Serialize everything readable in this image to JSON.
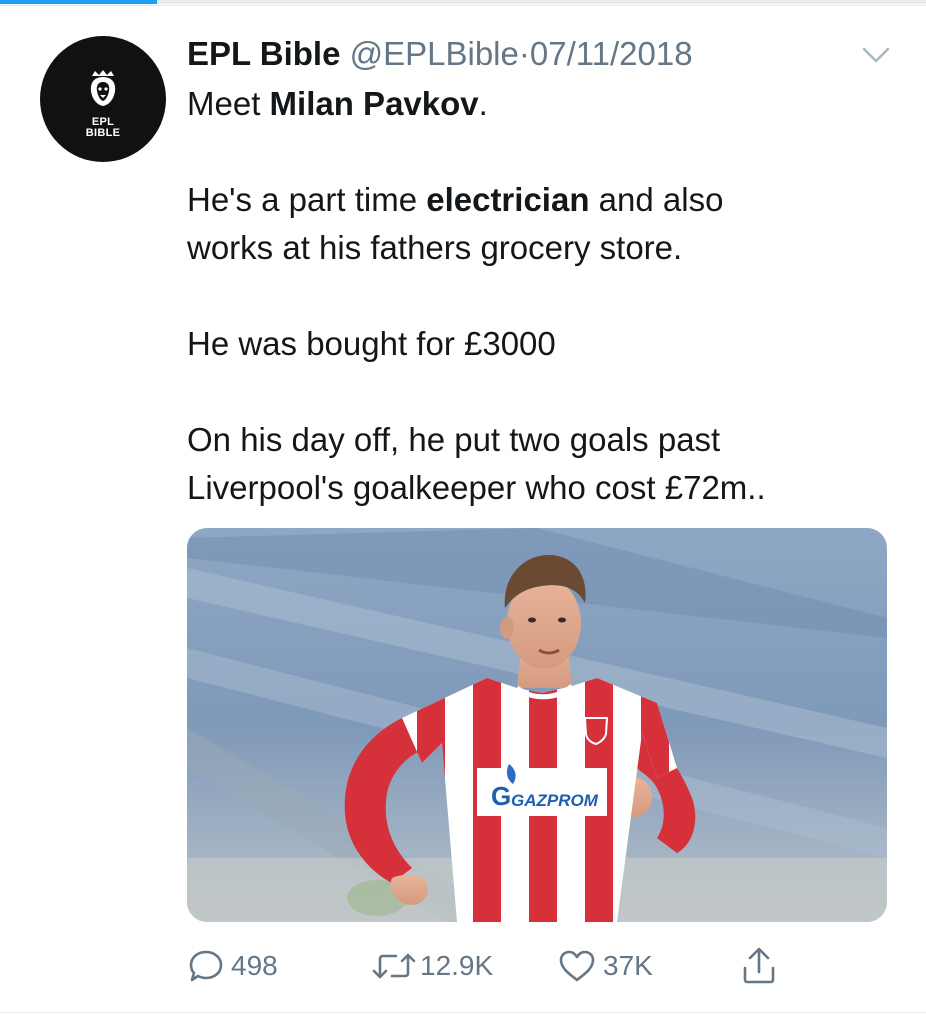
{
  "tweet": {
    "author_name": "EPL Bible",
    "handle": "@EPLBible",
    "separator": "·",
    "date": "07/11/2018",
    "avatar_text_top": "EPL",
    "avatar_text_bottom": "BIBLE",
    "line1_prefix": "Meet ",
    "line1_bold": "Milan Pavkov",
    "line1_suffix": ".",
    "line2_prefix": "He's a part time ",
    "line2_bold": "electrician",
    "line2_suffix": " and also",
    "line3": "works at his fathers grocery store.",
    "line4": "He was bought for £3000",
    "line5": "On his day off, he put two goals past",
    "line6": "Liverpool's goalkeeper who cost £72m..",
    "media_sponsor_text": "GAZPROM",
    "media_sponsor_letter": "G"
  },
  "actions": {
    "replies": "498",
    "retweets": "12.9K",
    "likes": "37K"
  },
  "icons": {
    "avatar": "lion-logo-icon",
    "menu": "chevron-down-icon",
    "reply": "reply-icon",
    "retweet": "retweet-icon",
    "like": "heart-icon",
    "share": "share-icon"
  },
  "colors": {
    "accent": "#1da1f2",
    "text": "#14171a",
    "secondary": "#657786",
    "divider": "#e6ecf0"
  },
  "top_progress": 0.17
}
